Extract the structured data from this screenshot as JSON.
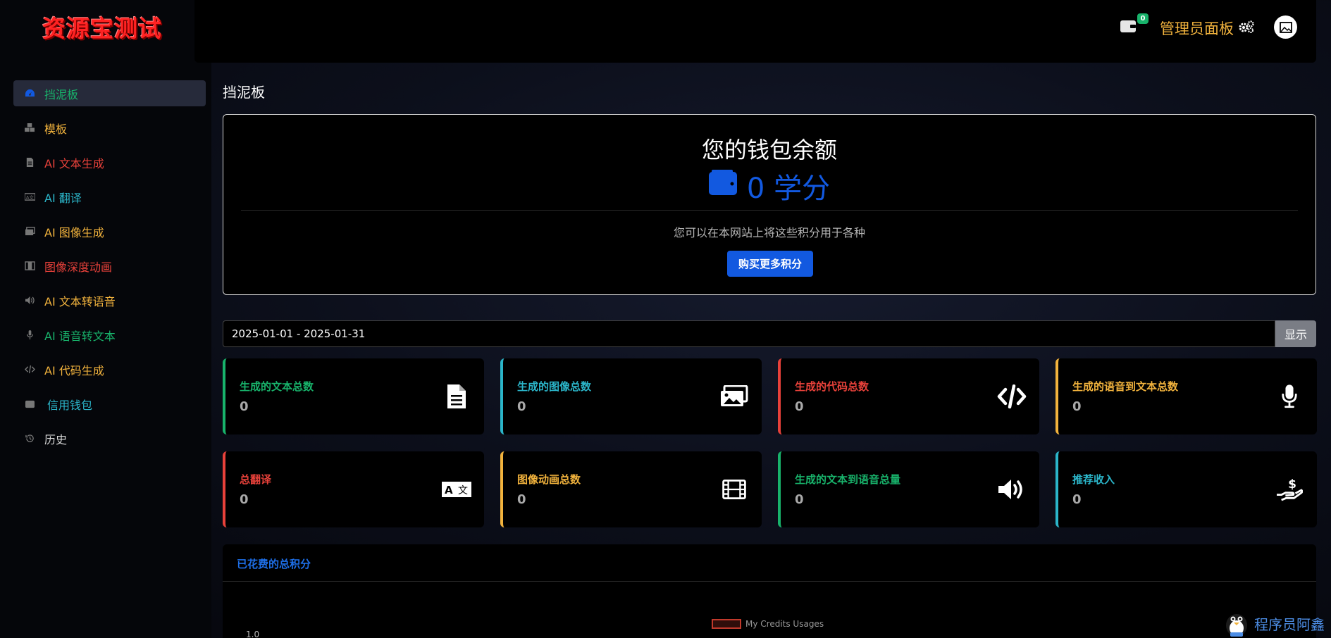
{
  "app": {
    "logo_text": "资源宝测试"
  },
  "sidebar": {
    "items": [
      {
        "label": "挡泥板",
        "icon": "dashboard-icon",
        "color": "#18b36b",
        "active": true
      },
      {
        "label": "模板",
        "icon": "cubes-icon",
        "color": "#f2b33d"
      },
      {
        "label": "AI 文本生成",
        "icon": "file-text-icon",
        "color": "#e8413a"
      },
      {
        "label": "AI 翻译",
        "icon": "language-icon",
        "color": "#2bb5c9"
      },
      {
        "label": "AI 图像生成",
        "icon": "images-icon",
        "color": "#f2b33d"
      },
      {
        "label": "图像深度动画",
        "icon": "film-icon",
        "color": "#e8413a"
      },
      {
        "label": "AI 文本转语音",
        "icon": "volume-icon",
        "color": "#f2b33d"
      },
      {
        "label": "AI 语音转文本",
        "icon": "microphone-icon",
        "color": "#18b36b"
      },
      {
        "label": "AI 代码生成",
        "icon": "code-icon",
        "color": "#f2b33d"
      },
      {
        "label": "信用钱包",
        "icon": "wallet-icon",
        "color": "#2bb5c9"
      },
      {
        "label": "历史",
        "icon": "history-icon",
        "color": "#d8d8d8"
      }
    ]
  },
  "topbar": {
    "wallet_badge": "0",
    "admin_label": "管理员面板"
  },
  "main": {
    "page_title": "挡泥板",
    "wallet": {
      "heading": "您的钱包余额",
      "balance": "0 学分",
      "description": "您可以在本网站上将这些积分用于各种",
      "buy_button": "购买更多积分"
    },
    "date_range": "2025-01-01 - 2025-01-31",
    "show_button": "显示",
    "stats": [
      {
        "label": "生成的文本总数",
        "value": "0",
        "color": "#18b36b",
        "icon": "file-text-icon"
      },
      {
        "label": "生成的图像总数",
        "value": "0",
        "color": "#2bb5c9",
        "icon": "images-icon"
      },
      {
        "label": "生成的代码总数",
        "value": "0",
        "color": "#e8413a",
        "icon": "code-icon"
      },
      {
        "label": "生成的语音到文本总数",
        "value": "0",
        "color": "#f2b33d",
        "icon": "microphone-icon"
      },
      {
        "label": "总翻译",
        "value": "0",
        "color": "#e8413a",
        "icon": "language-icon"
      },
      {
        "label": "图像动画总数",
        "value": "0",
        "color": "#f2b33d",
        "icon": "film-icon"
      },
      {
        "label": "生成的文本到语音总量",
        "value": "0",
        "color": "#18b36b",
        "icon": "volume-icon"
      },
      {
        "label": "推荐收入",
        "value": "0",
        "color": "#2bb5c9",
        "icon": "hand-dollar-icon"
      }
    ],
    "chart": {
      "title": "已花费的总积分",
      "legend": "My Credits Usages",
      "y_tick_top": "1.0"
    }
  },
  "watermark": {
    "text": "程序员阿鑫"
  }
}
